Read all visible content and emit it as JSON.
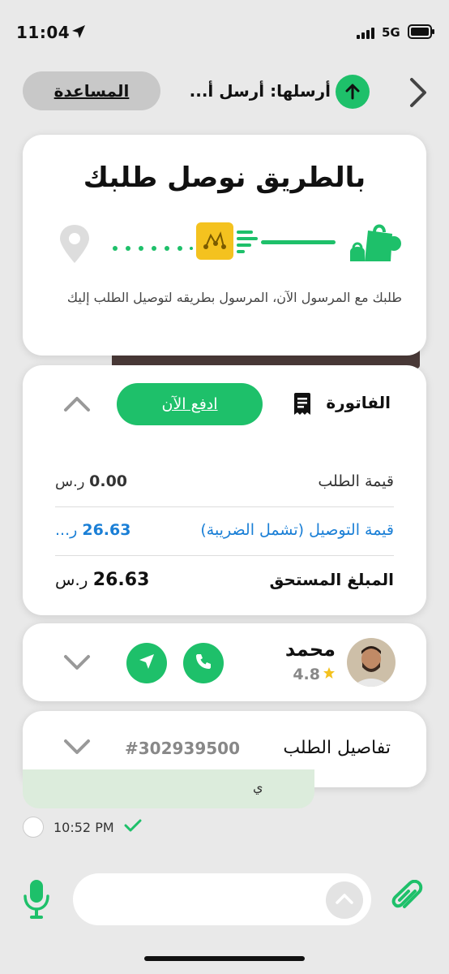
{
  "status_bar": {
    "time": "11:04",
    "network": "5G"
  },
  "header": {
    "help_label": "المساعدة",
    "send_text": "أرسلها: أرسل أ..."
  },
  "tracking": {
    "title": "بالطريق نوصل طلبك",
    "description": "طلبك مع المرسول الآن، المرسول بطريقه لتوصيل الطلب إليك"
  },
  "invoice": {
    "title": "الفاتورة",
    "pay_label": "ادفع الآن",
    "rows": [
      {
        "label": "قيمة الطلب",
        "amount": "0.00",
        "currency": "ر.س"
      },
      {
        "label": "قيمة التوصيل (تشمل الضريبة)",
        "amount": "26.63",
        "currency": "ر..."
      },
      {
        "label": "المبلغ المستحق",
        "amount": "26.63",
        "currency": "ر.س"
      }
    ]
  },
  "driver": {
    "name": "محمد",
    "rating": "4.8"
  },
  "order": {
    "title": "تفاصيل الطلب",
    "number": "#302939500"
  },
  "message": {
    "partial_text": "ي",
    "time": "10:52 PM"
  },
  "composer": {
    "placeholder": ""
  },
  "colors": {
    "accent": "#1ec06a",
    "link": "#1a7fd6",
    "receipt": "#f4c21f"
  },
  "icons": [
    "location-arrow-icon",
    "signal-icon",
    "battery-icon",
    "arrow-up-icon",
    "chevron-right-icon",
    "shopping-bags-icon",
    "receipt-icon",
    "map-pin-icon",
    "invoice-icon",
    "chevron-up-icon",
    "phone-icon",
    "navigate-icon",
    "chevron-down-icon",
    "star-icon",
    "check-icon",
    "microphone-icon",
    "paperclip-icon"
  ]
}
